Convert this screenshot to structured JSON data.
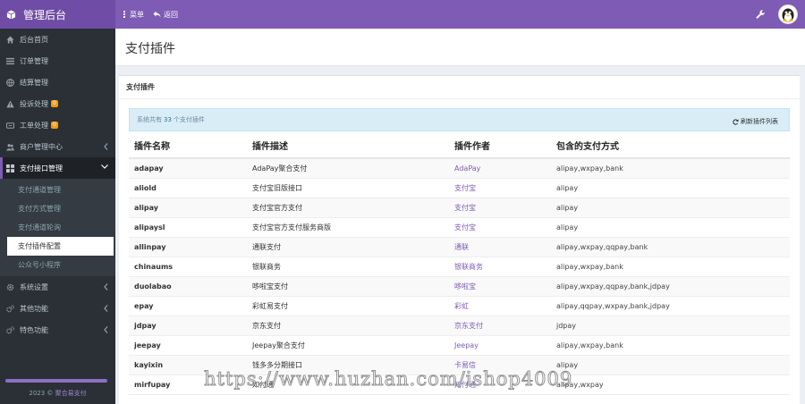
{
  "header": {
    "brand": "管理后台",
    "nav": [
      {
        "label": "菜单",
        "icon": "menu-icon"
      },
      {
        "label": "返回",
        "icon": "back-icon"
      }
    ],
    "tools": {
      "settings_icon": "wrench-icon",
      "avatar_icon": "avatar-icon"
    }
  },
  "colors": {
    "accent": "#7e5bb4",
    "sidebar": "#2b3036",
    "info_bg": "#d9edf7",
    "badge": "#f39c12"
  },
  "sidebar": {
    "items": [
      {
        "label": "后台首页",
        "icon": "home-icon"
      },
      {
        "label": "订单管理",
        "icon": "list-icon"
      },
      {
        "label": "结算管理",
        "icon": "globe-icon"
      },
      {
        "label": "投诉处理",
        "icon": "warning-icon",
        "badge": "0"
      },
      {
        "label": "工单处理",
        "icon": "ticket-icon",
        "badge": "0"
      },
      {
        "label": "商户管理中心",
        "icon": "users-icon"
      },
      {
        "label": "支付接口管理",
        "icon": "grid-icon"
      }
    ],
    "submenu": [
      {
        "label": "支付通道管理"
      },
      {
        "label": "支付方式管理"
      },
      {
        "label": "支付通道轮询"
      },
      {
        "label": "支付插件配置"
      },
      {
        "label": "公众号小程序"
      }
    ],
    "items_after": [
      {
        "label": "系统设置",
        "icon": "gear-icon"
      },
      {
        "label": "其他功能",
        "icon": "cogs-icon"
      },
      {
        "label": "特色功能",
        "icon": "star-icon"
      }
    ],
    "footer": {
      "year": "2023 ©",
      "link": "聚合易支付"
    }
  },
  "page": {
    "title": "支付插件",
    "box_title": "支付插件",
    "info_prefix": "系统共有",
    "info_count": "33",
    "info_suffix": "个支付插件",
    "refresh_label": "刷新插件列表"
  },
  "table": {
    "headers": [
      "插件名称",
      "插件描述",
      "插件作者",
      "包含的支付方式"
    ],
    "rows": [
      [
        "adapay",
        "AdaPay聚合支付",
        "AdaPay",
        "alipay,wxpay,bank"
      ],
      [
        "aliold",
        "支付宝旧版接口",
        "支付宝",
        "alipay"
      ],
      [
        "alipay",
        "支付宝官方支付",
        "支付宝",
        "alipay"
      ],
      [
        "alipaysl",
        "支付宝官方支付服务商版",
        "支付宝",
        "alipay"
      ],
      [
        "allinpay",
        "通联支付",
        "通联",
        "alipay,wxpay,qqpay,bank"
      ],
      [
        "chinaums",
        "银联商务",
        "银联商务",
        "alipay,wxpay,bank"
      ],
      [
        "duolabao",
        "哆啦宝支付",
        "哆啦宝",
        "alipay,wxpay,qqpay,bank,jdpay"
      ],
      [
        "epay",
        "彩虹易支付",
        "彩虹",
        "alipay,qqpay,wxpay,bank,jdpay"
      ],
      [
        "jdpay",
        "京东支付",
        "京东支付",
        "jdpay"
      ],
      [
        "jeepay",
        "Jeepay聚合支付",
        "Jeepay",
        "alipay,wxpay,bank"
      ],
      [
        "kayixin",
        "钱多多分期接口",
        "卡易信",
        "alipay"
      ],
      [
        "mirfupay",
        "知付通",
        "知付通",
        "alipay,wxpay"
      ]
    ]
  },
  "watermark": "https://www.huzhan.com/ishop4009"
}
